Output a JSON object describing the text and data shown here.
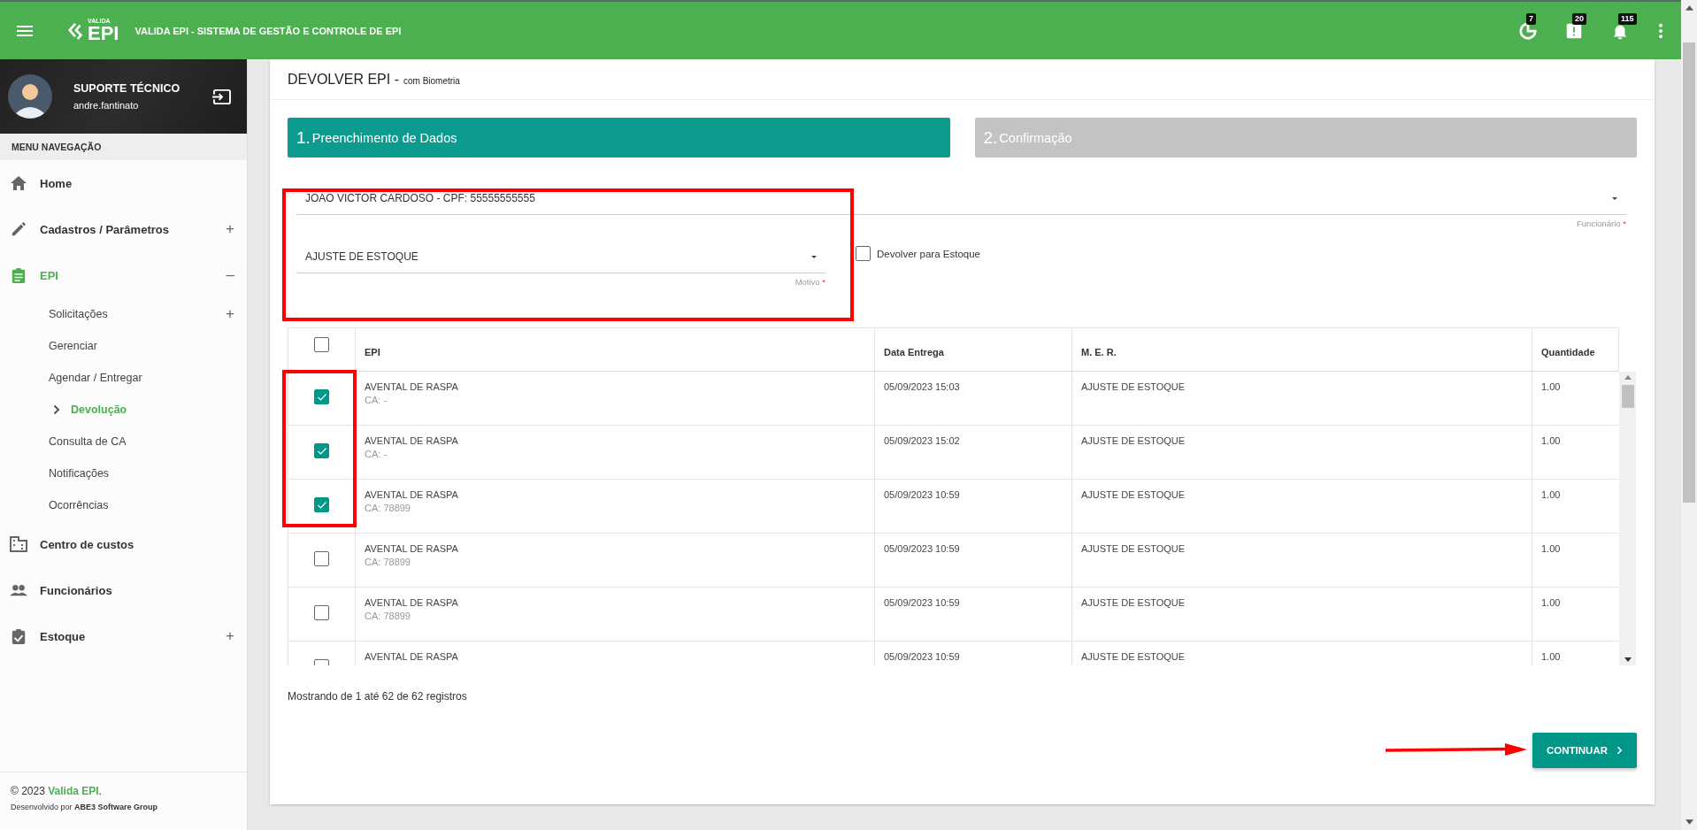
{
  "header": {
    "logo_small": "VALIDA",
    "logo_big": "EPI",
    "title": "VALIDA EPI - SISTEMA DE GESTÃO E CONTROLE DE EPI",
    "indicators": [
      {
        "kind": "clock",
        "count": "7"
      },
      {
        "kind": "alert",
        "count": "20"
      },
      {
        "kind": "bell",
        "count": "115"
      }
    ]
  },
  "user": {
    "name": "SUPORTE TÉCNICO",
    "login": "andre.fantinato"
  },
  "sidebar": {
    "heading": "MENU NAVEGAÇÃO",
    "items": [
      {
        "label": "Home",
        "expanded": false
      },
      {
        "label": "Cadastros / Parâmetros",
        "toggle": "+",
        "expanded": false
      },
      {
        "label": "EPI",
        "toggle": "–",
        "expanded": true,
        "children": [
          {
            "label": "Solicitações",
            "toggle": "+",
            "selected": false
          },
          {
            "label": "Gerenciar",
            "selected": false
          },
          {
            "label": "Agendar / Entregar",
            "selected": false
          },
          {
            "label": "Devolução",
            "selected": true
          },
          {
            "label": "Consulta de CA",
            "selected": false
          },
          {
            "label": "Notificações",
            "selected": false
          },
          {
            "label": "Ocorrências",
            "selected": false
          }
        ]
      },
      {
        "label": "Centro de custos",
        "expanded": false
      },
      {
        "label": "Funcionários",
        "expanded": false
      },
      {
        "label": "Estoque",
        "toggle": "+",
        "expanded": false
      }
    ],
    "footer": {
      "prefix": "© 2023",
      "brand": "Valida EPI",
      "suffix": ".",
      "credit": "Desenvolvido por **ABE3 Software Group**"
    }
  },
  "page": {
    "title": "DEVOLVER EPI -",
    "subtitle": "com Biometria",
    "steps": [
      {
        "number": "1.",
        "label": "Preenchimento de Dados",
        "selected": true
      },
      {
        "number": "2.",
        "label": "Confirmação",
        "selected": false
      }
    ],
    "employee": {
      "value": "JOAO VICTOR CARDOSO - CPF: 55555555555",
      "label": "Funcionário",
      "required_mark": "*"
    },
    "reason": {
      "value": "AJUSTE DE ESTOQUE",
      "label": "Motivo",
      "required_mark": "*"
    },
    "return_to_stock": {
      "label": "Devolver para Estoque",
      "checked": false
    },
    "table": {
      "select_all": false,
      "columns": [
        "EPI",
        "Data Entrega",
        "M. E. R.",
        "Quantidade"
      ],
      "rows": [
        {
          "selected": true,
          "epi": "AVENTAL DE RASPA",
          "ca": "CA: -",
          "date": "05/09/2023 15:03",
          "mer": "AJUSTE DE ESTOQUE",
          "qty": "1.00"
        },
        {
          "selected": true,
          "epi": "AVENTAL DE RASPA",
          "ca": "CA: -",
          "date": "05/09/2023 15:02",
          "mer": "AJUSTE DE ESTOQUE",
          "qty": "1.00"
        },
        {
          "selected": true,
          "epi": "AVENTAL DE RASPA",
          "ca": "CA: 78899",
          "date": "05/09/2023 10:59",
          "mer": "AJUSTE DE ESTOQUE",
          "qty": "1.00"
        },
        {
          "selected": false,
          "epi": "AVENTAL DE RASPA",
          "ca": "CA: 78899",
          "date": "05/09/2023 10:59",
          "mer": "AJUSTE DE ESTOQUE",
          "qty": "1.00"
        },
        {
          "selected": false,
          "epi": "AVENTAL DE RASPA",
          "ca": "CA: 78899",
          "date": "05/09/2023 10:59",
          "mer": "AJUSTE DE ESTOQUE",
          "qty": "1.00"
        },
        {
          "selected": false,
          "epi": "AVENTAL DE RASPA",
          "date": "05/09/2023 10:59",
          "mer": "AJUSTE DE ESTOQUE",
          "qty": "1.00"
        }
      ]
    },
    "record_info": "Mostrando de 1 até 62 de 62 registros",
    "continue": "CONTINUAR"
  }
}
